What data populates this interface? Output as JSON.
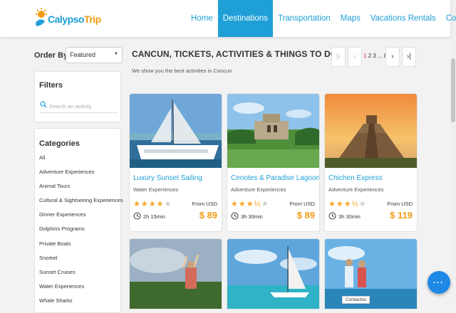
{
  "brand": {
    "part1": "Calypso",
    "part2": "Trip",
    "color_primary": "#1e9fd6",
    "color_accent": "#f39c12"
  },
  "nav": [
    {
      "label": "Home",
      "active": false
    },
    {
      "label": "Destinations",
      "active": true
    },
    {
      "label": "Transportation",
      "active": false
    },
    {
      "label": "Maps",
      "active": false
    },
    {
      "label": "Vacations Rentals",
      "active": false
    },
    {
      "label": "Contact",
      "active": false
    }
  ],
  "sidebar": {
    "order_by_label": "Order By",
    "order_by_value": "Featured",
    "filters_title": "Filters",
    "search_placeholder": "Search an activity",
    "categories_title": "Categories",
    "categories": [
      "All",
      "Adventure Experiences",
      "Animal Tours",
      "Cultural & Sightseeing Experiences",
      "Dinner Experiences",
      "Dolphins Programs",
      "Private Boats",
      "Snorkel",
      "Sunset Cruises",
      "Water Experiences",
      "Whale Sharks"
    ]
  },
  "main": {
    "title": "CANCUN, TICKETS, ACTIVITIES & THINGS TO DO",
    "subtitle": "We show you the best activities in Cancun",
    "pagination": {
      "first": "|‹",
      "prev": "‹",
      "next": "›",
      "last": "›|",
      "current": "1",
      "rest": "2 3 ... 8"
    }
  },
  "cards": [
    {
      "title": "Luxury Sunset Sailing",
      "category": "Water Experiences",
      "rating": 4,
      "from": "From USD",
      "duration": "2h 15min",
      "price": "$ 89"
    },
    {
      "title": "Cenotes & Paradise Lagoon",
      "category": "Adventure Experiences",
      "rating": 3.5,
      "from": "From USD",
      "duration": "3h 30min",
      "price": "$ 89"
    },
    {
      "title": "Chichen Express",
      "category": "Adventure Experiences",
      "rating": 3.5,
      "from": "From USD",
      "duration": "3h 30min",
      "price": "$ 119"
    }
  ],
  "chat": {
    "icon": "chat-bubble-icon",
    "tooltip": "Contactos"
  }
}
